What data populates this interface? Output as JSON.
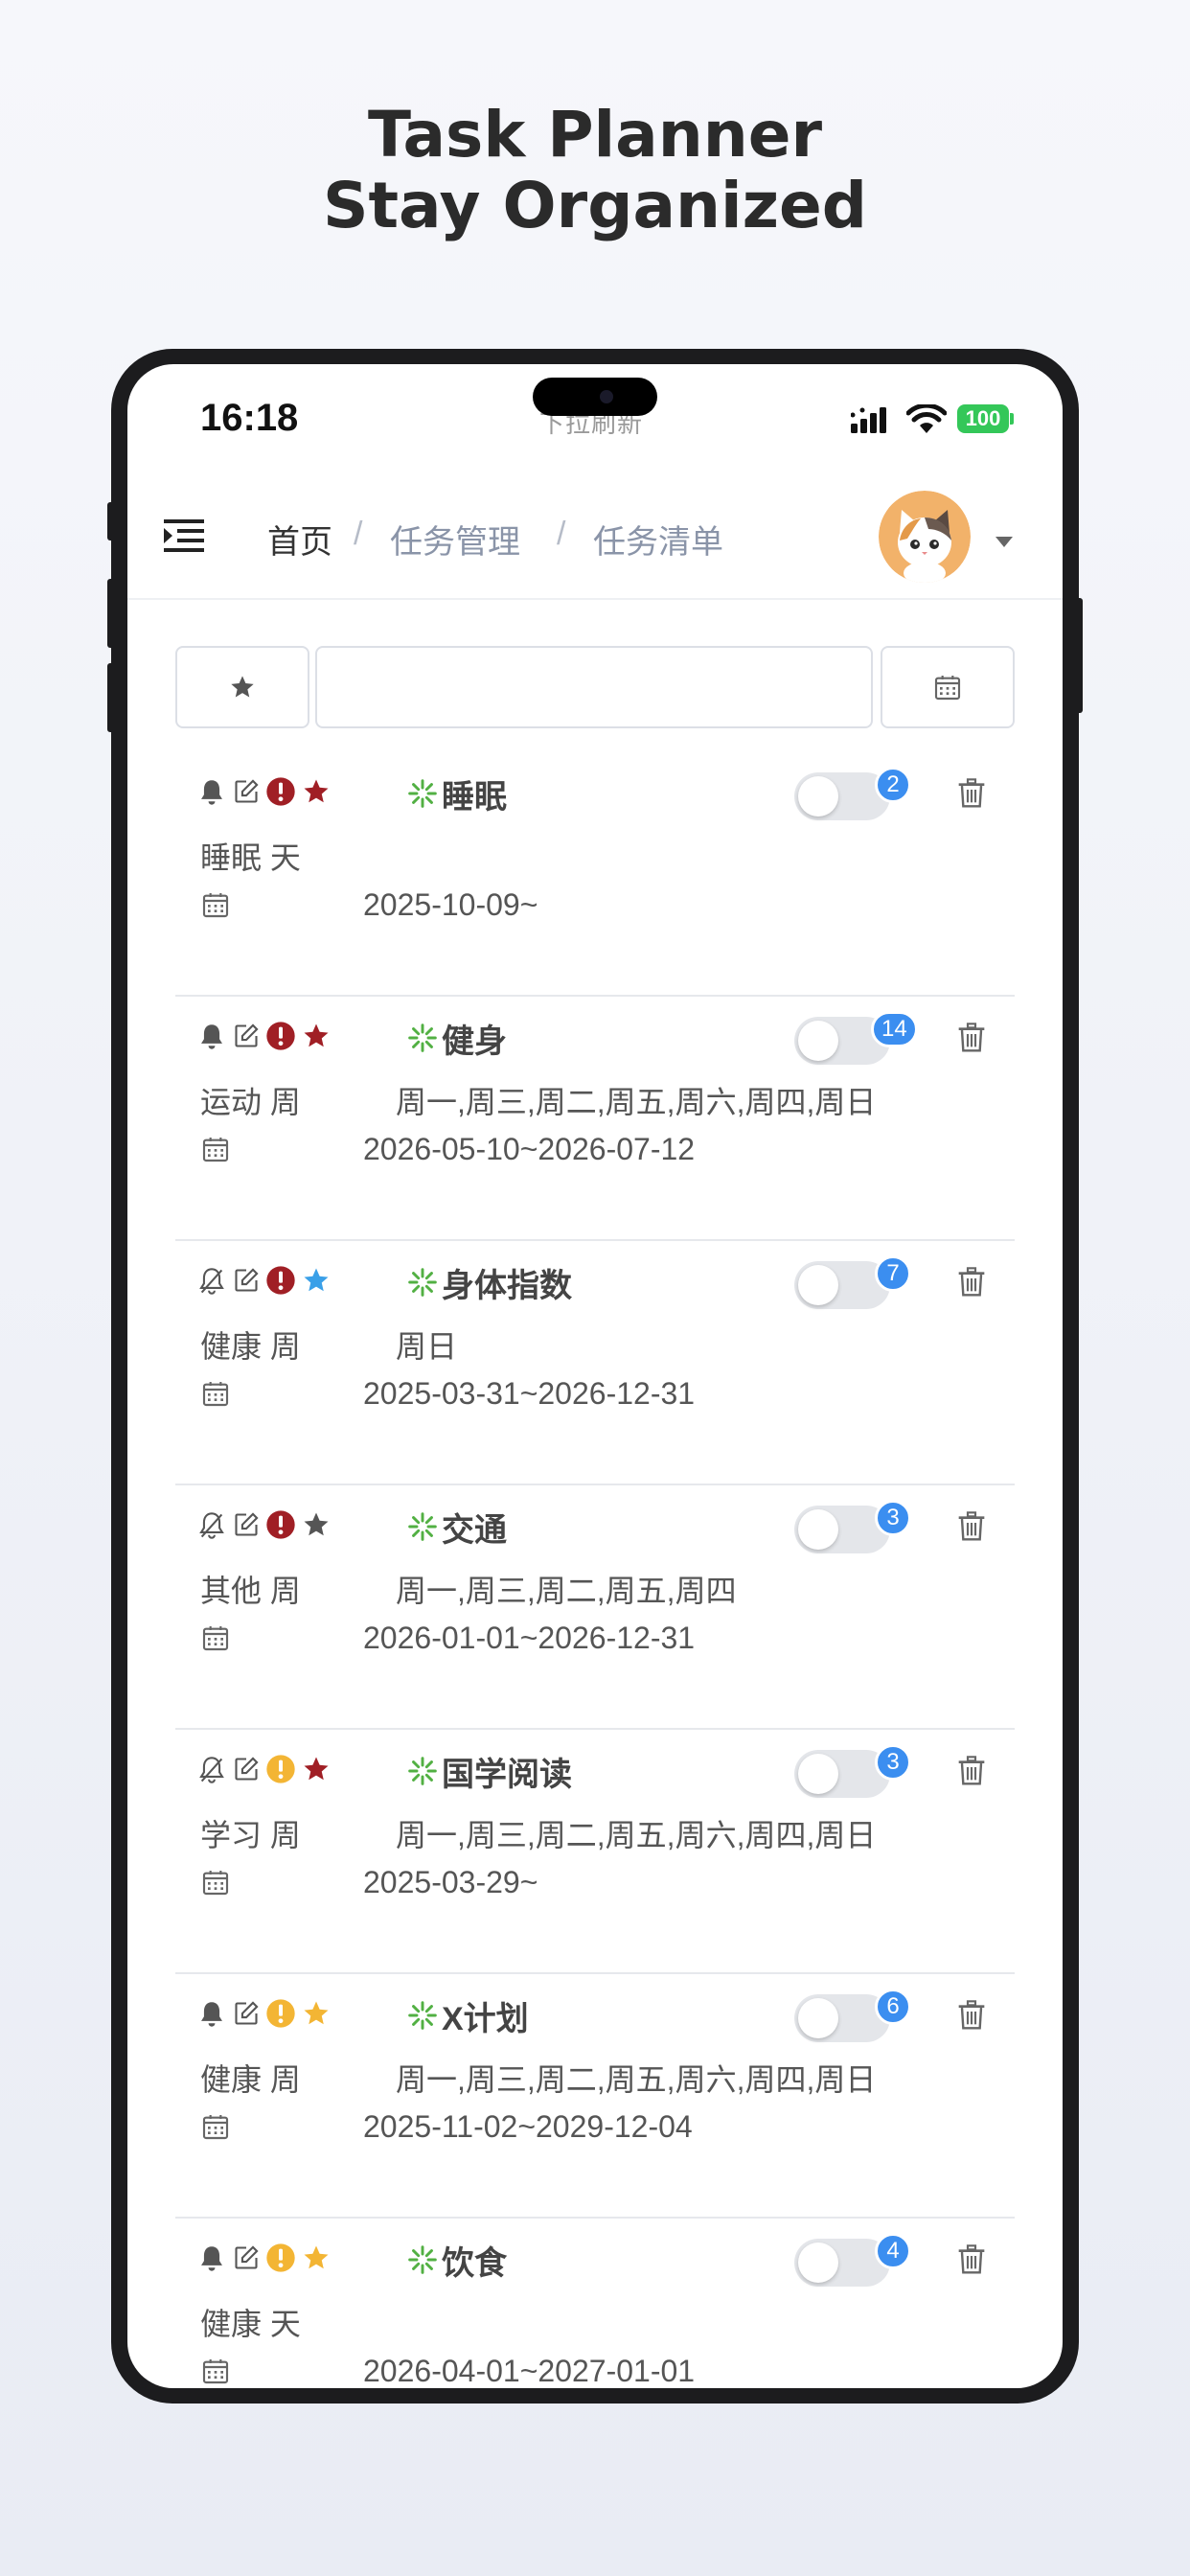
{
  "headline": {
    "line1": "Task Planner",
    "line2": "Stay Organized"
  },
  "status_bar": {
    "time": "16:18",
    "pull_text": "下拉刷新",
    "battery": "100"
  },
  "breadcrumb": {
    "home": "首页",
    "sep": "/",
    "management": "任务管理",
    "list": "任务清单"
  },
  "filter": {
    "search_placeholder": ""
  },
  "colors": {
    "accent": "#3b8ef0",
    "spinner": "#52b043",
    "priority_red": "#a01f25",
    "priority_yellow": "#f3b534",
    "star_blue": "#3aa0e8",
    "star_gray": "#555555"
  },
  "tasks": [
    {
      "name": "睡眠",
      "category": "睡眠 天",
      "days": "",
      "range": "2025-10-09~",
      "badge": "2",
      "bell": "on",
      "alert": "red",
      "star": "red"
    },
    {
      "name": "健身",
      "category": "运动 周",
      "days": "周一,周三,周二,周五,周六,周四,周日",
      "range": "2026-05-10~2026-07-12",
      "badge": "14",
      "bell": "on",
      "alert": "red",
      "star": "red"
    },
    {
      "name": "身体指数",
      "category": "健康 周",
      "days": "周日",
      "range": "2025-03-31~2026-12-31",
      "badge": "7",
      "bell": "off",
      "alert": "red",
      "star": "blue"
    },
    {
      "name": "交通",
      "category": "其他 周",
      "days": "周一,周三,周二,周五,周四",
      "range": "2026-01-01~2026-12-31",
      "badge": "3",
      "bell": "off",
      "alert": "red",
      "star": "gray"
    },
    {
      "name": "国学阅读",
      "category": "学习 周",
      "days": "周一,周三,周二,周五,周六,周四,周日",
      "range": "2025-03-29~",
      "badge": "3",
      "bell": "off",
      "alert": "yellow",
      "star": "red"
    },
    {
      "name": "X计划",
      "category": "健康 周",
      "days": "周一,周三,周二,周五,周六,周四,周日",
      "range": "2025-11-02~2029-12-04",
      "badge": "6",
      "bell": "on",
      "alert": "yellow",
      "star": "yellow"
    },
    {
      "name": "饮食",
      "category": "健康 天",
      "days": "",
      "range": "2026-04-01~2027-01-01",
      "badge": "4",
      "bell": "on",
      "alert": "yellow",
      "star": "yellow"
    }
  ]
}
